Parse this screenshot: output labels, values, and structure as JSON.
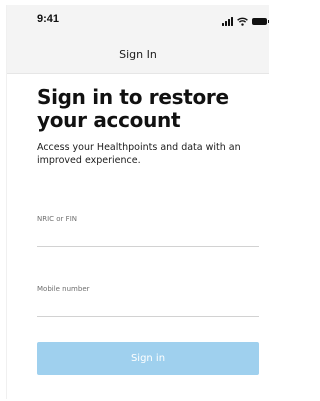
{
  "status_bar": {
    "time": "9:41",
    "icons": [
      "signal-icon",
      "wifi-icon",
      "battery-icon"
    ]
  },
  "nav": {
    "title": "Sign In"
  },
  "main": {
    "heading": "Sign in to restore your account",
    "description": "Access your Healthpoints and data with an improved experience.",
    "fields": [
      {
        "label": "NRIC or FIN",
        "value": "",
        "placeholder": ""
      },
      {
        "label": "Mobile number",
        "value": "",
        "placeholder": ""
      }
    ],
    "submit_label": "Sign in"
  },
  "colors": {
    "button_disabled": "#9fd0ee",
    "text_primary": "#111111",
    "label_gray": "#6f6f6f",
    "bar_background": "#f4f4f4"
  }
}
